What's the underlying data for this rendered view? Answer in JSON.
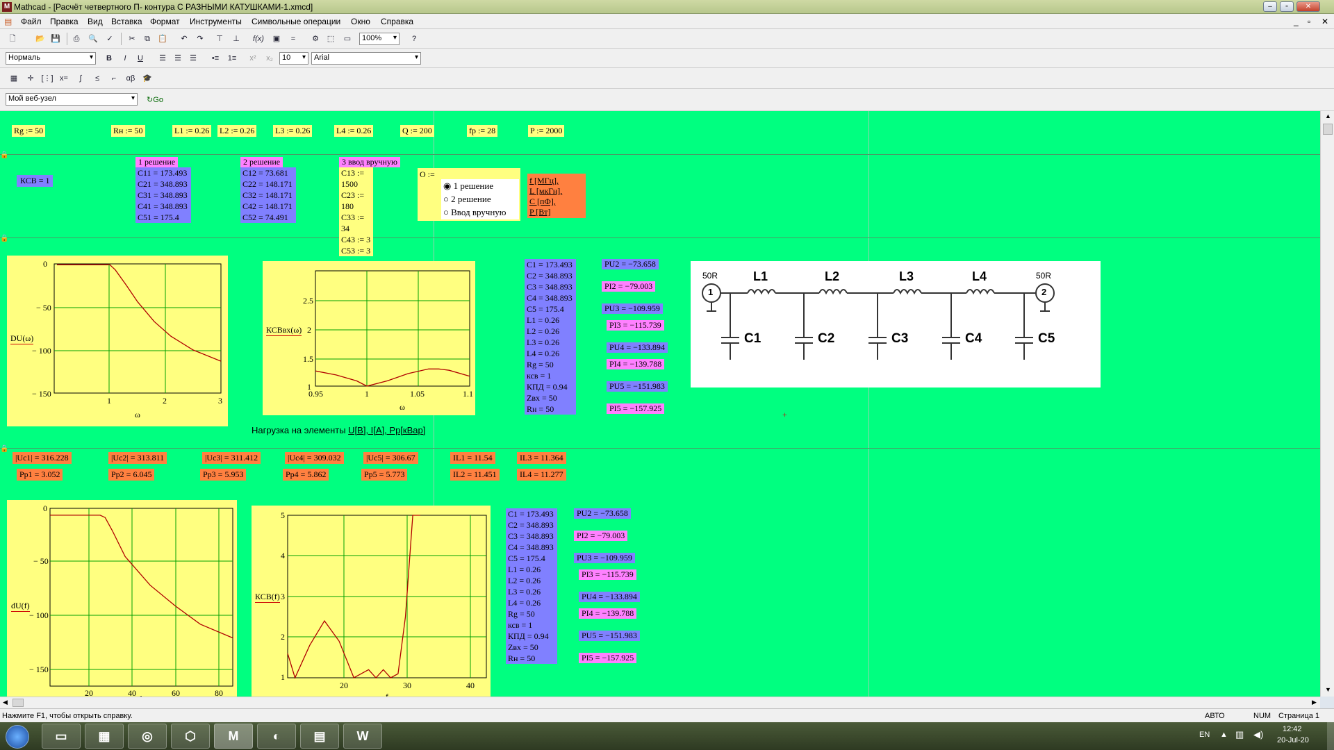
{
  "window": {
    "title": "Mathcad - [Расчёт четвертного П- контура С РАЗНЫМИ КАТУШКАМИ-1.xmcd]",
    "app_icon": "M"
  },
  "menu": [
    "Файл",
    "Правка",
    "Вид",
    "Вставка",
    "Формат",
    "Инструменты",
    "Символьные операции",
    "Окно",
    "Справка"
  ],
  "toolbar": {
    "zoom": "100%",
    "style": "Нормаль",
    "font_size": "10",
    "font": "Arial",
    "web": "Мой веб-узел",
    "go": "Go",
    "bold": "B",
    "italic": "I",
    "underline": "U"
  },
  "params": [
    "Rg := 50",
    "Rн := 50",
    "L1 := 0.26",
    "L2 := 0.26",
    "L3 := 0.26",
    "L4 := 0.26",
    "Q := 200",
    "fp := 28",
    "P := 2000"
  ],
  "ksv": "КСВ = 1",
  "solution1": {
    "title": "1 решение",
    "lines": [
      "C11 = 173.493",
      "C21 = 348.893",
      "C31 = 348.893",
      "C41 = 348.893",
      "C51 = 175.4"
    ]
  },
  "solution2": {
    "title": "2 решение",
    "lines": [
      "C12 = 73.681",
      "C22 = 148.171",
      "C32 = 148.171",
      "C42 = 148.171",
      "C52 = 74.491"
    ]
  },
  "solution3": {
    "title": "3 ввод вручную",
    "lines": [
      "C13 := 1500",
      "C23 := 180",
      "C33 := 34",
      "C43 := 3",
      "C53 := 3"
    ]
  },
  "options": {
    "label": "O :=",
    "items": [
      "1 решение",
      "2 решение",
      "Ввод вручную"
    ],
    "selected": 0
  },
  "units": [
    "f [МГц],",
    "L [мкГн],",
    "C [пФ],",
    "P [Вт]"
  ],
  "values_list": [
    "C1 = 173.493",
    "C2 = 348.893",
    "C3 = 348.893",
    "C4 = 348.893",
    "C5 = 175.4",
    "L1 = 0.26",
    "L2 = 0.26",
    "L3 = 0.26",
    "L4 = 0.26",
    "Rg = 50",
    "ксв = 1",
    "КПД = 0.94",
    "Zвх = 50",
    "Rн = 50"
  ],
  "p_values": [
    "PU2 = −73.658",
    "PI2 = −79.003",
    "PU3 = −109.959",
    "PI3 = −115.739",
    "PU4 = −133.894",
    "PI4 = −139.788",
    "PU5 = −151.983",
    "PI5 = −157.925"
  ],
  "load_caption": "Нагрузка на элементы ",
  "load_caption_u": "U[B], I[A], Pp[кВар]",
  "loads": {
    "u": [
      "|Uc1| = 316.228",
      "|Uc2| = 313.811",
      "|Uc3| = 311.412",
      "|Uc4| = 309.032",
      "|Uc5| = 306.67"
    ],
    "pp": [
      "Pp1 = 3.052",
      "Pp2 = 6.045",
      "Pp3 = 5.953",
      "Pp4 = 5.862",
      "Pp5 = 5.773"
    ],
    "i": [
      "IL1 = 11.54",
      "IL2 = 11.451",
      "IL3 = 11.364",
      "IL4 = 11.277"
    ]
  },
  "schematic": {
    "port_left": "50R",
    "port_right": "50R",
    "inductors": [
      "L1",
      "L2",
      "L3",
      "L4"
    ],
    "caps": [
      "C1",
      "C2",
      "C3",
      "C4",
      "C5"
    ],
    "port1": "1",
    "port2": "2"
  },
  "plot1": {
    "ylabel": "DU(ω)",
    "xlabel": "ω",
    "yticks": [
      "0",
      "− 50",
      "− 100",
      "− 150"
    ],
    "xticks": [
      "1",
      "2",
      "3"
    ]
  },
  "plot2": {
    "ylabel": "КСВвх(ω)",
    "xlabel": "ω",
    "yticks": [
      "2.5",
      "2",
      "1.5",
      "1"
    ],
    "xticks": [
      "0.95",
      "1",
      "1.05",
      "1.1"
    ]
  },
  "plot3": {
    "ylabel": "dU(f)",
    "xlabel": "f",
    "yticks": [
      "0",
      "− 50",
      "− 100",
      "− 150"
    ],
    "xticks": [
      "20",
      "40",
      "60",
      "80"
    ]
  },
  "plot4": {
    "ylabel": "КСВ(f)",
    "xlabel": "f",
    "yticks": [
      "5",
      "4",
      "3",
      "2",
      "1"
    ],
    "xticks": [
      "20",
      "30",
      "40"
    ]
  },
  "chart_data": [
    {
      "type": "line",
      "ylabel": "DU(ω)",
      "xlabel": "ω",
      "xlim": [
        0,
        3
      ],
      "ylim": [
        -150,
        0
      ],
      "x": [
        0.05,
        0.5,
        1.0,
        1.1,
        1.3,
        1.5,
        1.8,
        2.1,
        2.5,
        3.0
      ],
      "y": [
        -1,
        -1,
        -1,
        -7,
        -25,
        -44,
        -67,
        -84,
        -100,
        -113
      ]
    },
    {
      "type": "line",
      "ylabel": "КСВвх(ω)",
      "xlabel": "ω",
      "xlim": [
        0.95,
        1.1
      ],
      "ylim": [
        1,
        2.75
      ],
      "x": [
        0.95,
        0.97,
        0.99,
        1.0,
        1.02,
        1.04,
        1.06,
        1.07,
        1.08,
        1.1
      ],
      "y": [
        1.23,
        1.17,
        1.08,
        1.0,
        1.08,
        1.19,
        1.26,
        1.26,
        1.24,
        1.15
      ]
    },
    {
      "type": "line",
      "ylabel": "dU(f)",
      "xlabel": "f",
      "xlim": [
        10,
        83
      ],
      "ylim": [
        -150,
        5
      ],
      "x": [
        10,
        20,
        30,
        32,
        35,
        40,
        50,
        60,
        70,
        83
      ],
      "y": [
        -1,
        -1,
        -1,
        -3,
        -15,
        -37,
        -62,
        -80,
        -96,
        -108
      ]
    },
    {
      "type": "line",
      "ylabel": "КСВ(f)",
      "xlabel": "f",
      "xlim": [
        15,
        42
      ],
      "ylim": [
        1,
        5
      ],
      "x": [
        15,
        16,
        18,
        20,
        22,
        24,
        26,
        27,
        28,
        29,
        30,
        31,
        32,
        33
      ],
      "y": [
        1.6,
        1.0,
        1.8,
        2.4,
        1.9,
        1.0,
        1.2,
        1.0,
        1.2,
        1.0,
        1.1,
        2.5,
        5.0,
        5.0
      ]
    }
  ],
  "status": {
    "help": "Нажмите F1, чтобы открыть справку.",
    "auto": "АВТО",
    "num": "NUM",
    "page": "Страница 1"
  },
  "tray": {
    "lang": "EN",
    "time": "12:42",
    "date": "20-Jul-20"
  }
}
